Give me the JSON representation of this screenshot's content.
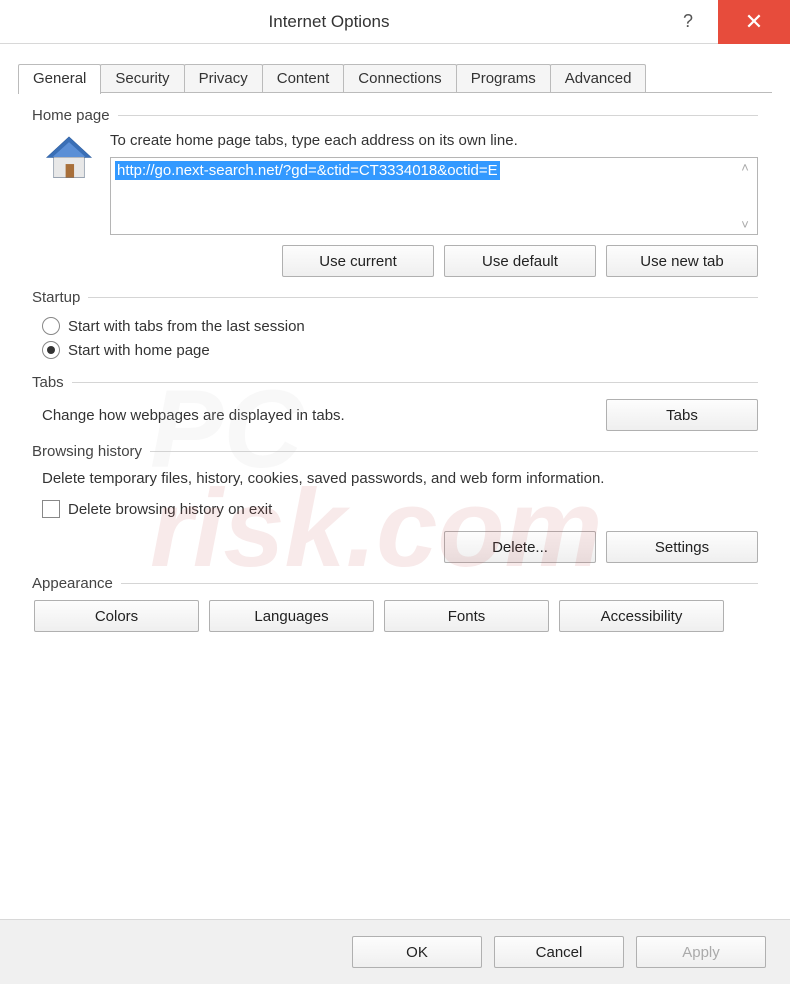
{
  "window": {
    "title": "Internet Options"
  },
  "tabs": {
    "items": [
      "General",
      "Security",
      "Privacy",
      "Content",
      "Connections",
      "Programs",
      "Advanced"
    ],
    "active": 0
  },
  "homepage": {
    "group_title": "Home page",
    "instruction": "To create home page tabs, type each address on its own line.",
    "url_value": "http://go.next-search.net/?gd=&ctid=CT3334018&octid=E",
    "use_current": "Use current",
    "use_default": "Use default",
    "use_new_tab": "Use new tab"
  },
  "startup": {
    "group_title": "Startup",
    "option_last_session": "Start with tabs from the last session",
    "option_home_page": "Start with home page"
  },
  "tabs_section": {
    "group_title": "Tabs",
    "text": "Change how webpages are displayed in tabs.",
    "button": "Tabs"
  },
  "history": {
    "group_title": "Browsing history",
    "text": "Delete temporary files, history, cookies, saved passwords, and web form information.",
    "checkbox_label": "Delete browsing history on exit",
    "delete_button": "Delete...",
    "settings_button": "Settings"
  },
  "appearance": {
    "group_title": "Appearance",
    "colors": "Colors",
    "languages": "Languages",
    "fonts": "Fonts",
    "accessibility": "Accessibility"
  },
  "footer": {
    "ok": "OK",
    "cancel": "Cancel",
    "apply": "Apply"
  }
}
